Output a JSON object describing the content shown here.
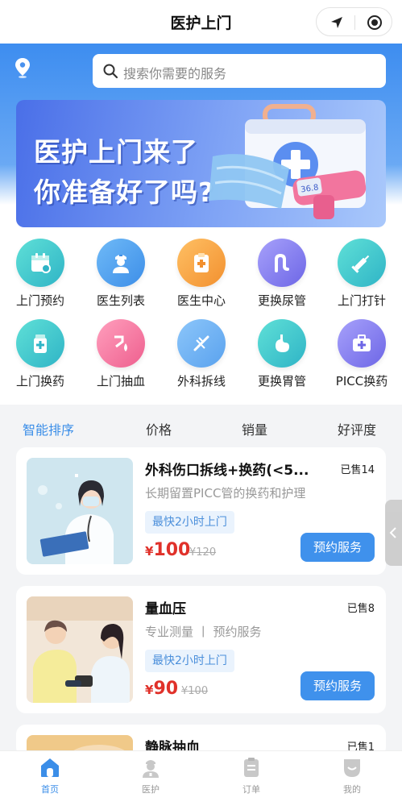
{
  "header": {
    "title": "医护上门"
  },
  "search": {
    "placeholder": "搜索你需要的服务"
  },
  "banner": {
    "line1": "医护上门来了",
    "line2": "你准备好了吗?"
  },
  "grid": [
    {
      "label": "上门预约",
      "icon": "calendar-icon",
      "color": "#3fc9c8"
    },
    {
      "label": "医生列表",
      "icon": "doctor-icon",
      "color": "#4aa6f0"
    },
    {
      "label": "医生中心",
      "icon": "clipboard-icon",
      "color": "#f5a443"
    },
    {
      "label": "更换尿管",
      "icon": "catheter-icon",
      "color": "#8b85f0"
    },
    {
      "label": "上门打针",
      "icon": "syringe-icon",
      "color": "#3fc9c8"
    },
    {
      "label": "上门换药",
      "icon": "medicine-icon",
      "color": "#3fc9c8"
    },
    {
      "label": "上门抽血",
      "icon": "blood-draw-icon",
      "color": "#f27aa0"
    },
    {
      "label": "外科拆线",
      "icon": "suture-icon",
      "color": "#4aa6f0"
    },
    {
      "label": "更换胃管",
      "icon": "stomach-icon",
      "color": "#3fc9c8"
    },
    {
      "label": "PICC换药",
      "icon": "medkit-icon",
      "color": "#8b85f0"
    }
  ],
  "sort": [
    "智能排序",
    "价格",
    "销量",
    "好评度"
  ],
  "cards": [
    {
      "name": "外科伤口拆线+换药(<5...",
      "sold": "已售14",
      "desc": "长期留置PICC管的换药和护理",
      "tag": "最快2小时上门",
      "currency": "¥",
      "price": "100",
      "orig": "¥120",
      "button": "预约服务"
    },
    {
      "name": "量血压",
      "sold": "已售8",
      "desc": "专业测量 丨 预约服务",
      "tag": "最快2小时上门",
      "currency": "¥",
      "price": "90",
      "orig": "¥100",
      "button": "预约服务"
    },
    {
      "name": "静脉抽血",
      "sold": "已售1"
    }
  ],
  "tabs": [
    {
      "label": "首页",
      "icon": "home-icon"
    },
    {
      "label": "医护",
      "icon": "nurse-icon"
    },
    {
      "label": "订单",
      "icon": "order-icon"
    },
    {
      "label": "我的",
      "icon": "profile-icon"
    }
  ],
  "colors": {
    "accent": "#3b8ee8",
    "price": "#e0312a"
  }
}
